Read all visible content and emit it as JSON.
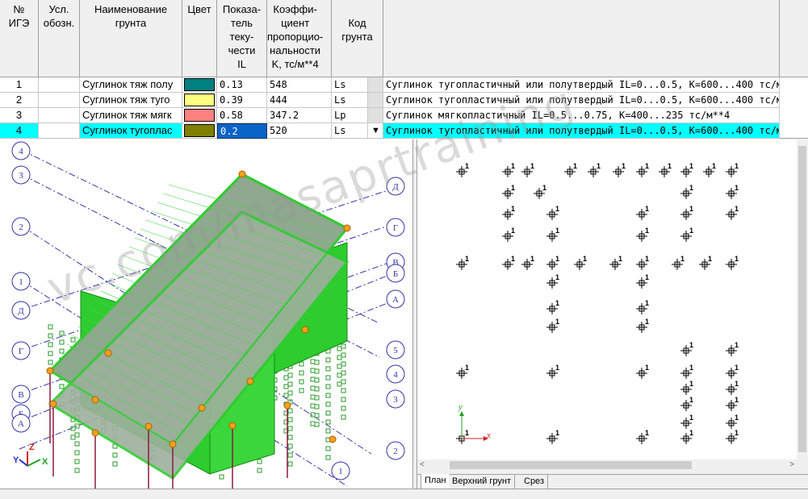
{
  "table": {
    "headers": {
      "num": "№\nИГЭ",
      "symbol": "Усл.\nобозн.",
      "name": "Наименование\nгрунта",
      "color": "Цвет",
      "il": "Показа-\nтель\nтеку-\nчести\nIL",
      "k": "Коэффи-\nциент\nпропорцио-\nнальности\nK, тс/м**4",
      "code": "Код\nгрунта"
    },
    "rows": [
      {
        "num": "1",
        "name": "Суглинок тяж полу",
        "color": "#008080",
        "il": "0.13",
        "k": "548",
        "code": "Ls",
        "desc": "Суглинок тугопластичный или полутвердый IL=0...0.5, K=600...400 тс/м**4"
      },
      {
        "num": "2",
        "name": "Суглинок тяж туго",
        "color": "#ffff80",
        "il": "0.39",
        "k": "444",
        "code": "Ls",
        "desc": "Суглинок тугопластичный или полутвердый IL=0...0.5, K=600...400 тс/м**4"
      },
      {
        "num": "3",
        "name": "Суглинок тяж мягк",
        "color": "#ff8080",
        "il": "0.58",
        "k": "347.2",
        "code": "Lp",
        "desc": "Суглинок мягкопластичный IL=0.5...0.75, K=400...235 тс/м**4"
      },
      {
        "num": "4",
        "name": "Суглинок тугоплас",
        "color": "#808000",
        "il": "0.2",
        "k": "520",
        "code": "Ls",
        "desc": "Суглинок тугопластичный или полутвердый IL=0...0.5, K=600...400 тс/м**4"
      }
    ],
    "selected_row": 4,
    "dropdown_icon": "▼"
  },
  "axes3d": {
    "left_labels": [
      "4",
      "3",
      "2",
      "1",
      "Д",
      "Г",
      "В",
      "Б",
      "А"
    ],
    "right_labels": [
      "Д",
      "Г",
      "В",
      "Б",
      "А",
      "5",
      "4",
      "3",
      "2",
      "1"
    ],
    "triad": {
      "x": "X",
      "y": "Y",
      "z": "Z"
    }
  },
  "plan": {
    "node_label": "1",
    "axis_x": "x",
    "axis_y": "y"
  },
  "tabs": [
    "План",
    "Верхний грунт",
    "Срез"
  ],
  "active_tab": "План",
  "scroll": {
    "left": "<",
    "right": ">"
  },
  "watermark": "vc.com/masaprtraining",
  "colors": {
    "selected": "#00ffff",
    "mesh": "#2ecc2e",
    "slab": "#8fa88f",
    "axis": "#3333aa"
  }
}
